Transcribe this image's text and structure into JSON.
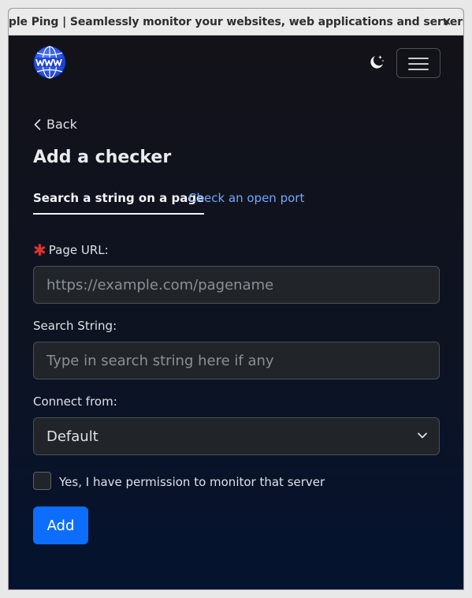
{
  "window": {
    "title": "Simple Ping | Seamlessly monitor your websites, web applications and servers",
    "close_glyph": "×"
  },
  "navbar": {
    "logo_icon": "globe-www-icon",
    "theme_icon": "moon-stars-icon",
    "menu_icon": "hamburger-icon"
  },
  "page": {
    "back_label": "Back",
    "title": "Add a checker"
  },
  "tabs": [
    {
      "label": "Search a string on a page",
      "active": true
    },
    {
      "label": "Check an open port",
      "active": false
    }
  ],
  "form": {
    "page_url": {
      "label": "Page URL:",
      "required": true,
      "required_mark": "✱",
      "value": "",
      "placeholder": "https://example.com/pagename"
    },
    "search_string": {
      "label": "Search String:",
      "value": "",
      "placeholder": "Type in search string here if any"
    },
    "connect_from": {
      "label": "Connect from:",
      "selected": "Default"
    },
    "permission": {
      "label": "Yes, I have permission to monitor that server",
      "checked": false
    },
    "submit_label": "Add"
  },
  "colors": {
    "accent": "#0d6efd",
    "link": "#6ea8fe",
    "required": "#e03131",
    "input_bg": "#212529",
    "page_bg_top": "#121218",
    "page_bg_bottom": "#04132f"
  }
}
